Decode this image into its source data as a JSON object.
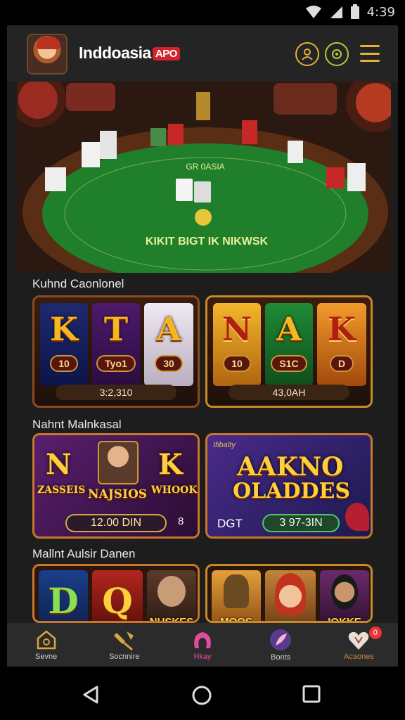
{
  "status_bar": {
    "time": "4:39"
  },
  "header": {
    "brand": "Inddoasia",
    "brand_badge": "APO"
  },
  "hero": {
    "table_text_top": "GR 0ASIA",
    "table_text_bottom": "KIKIT BIGT IK NIKWSK"
  },
  "sections": [
    {
      "title": "Kuhnd Caonlonel",
      "slots": [
        {
          "reels": [
            {
              "letter": "K",
              "chip": "10"
            },
            {
              "letter": "T",
              "chip": "Tyo1"
            },
            {
              "letter": "A",
              "chip": "30"
            }
          ],
          "footer": "3:2,310"
        },
        {
          "reels": [
            {
              "letter": "N",
              "chip": "10"
            },
            {
              "letter": "A",
              "chip": "S1C"
            },
            {
              "letter": "K",
              "chip": "D"
            }
          ],
          "footer": "43,0AH"
        }
      ]
    },
    {
      "title": "Nahnt Malnkasal",
      "left_card": {
        "letter_left": "N",
        "letter_right": "K",
        "banner_left": "ZASSEIS",
        "banner_mid": "NAJSIOS",
        "banner_right": "WHOOKE",
        "pill": "12.00 DIN",
        "pill_suffix": "8"
      },
      "right_card": {
        "tag": "Ifibalty",
        "title_line1": "AAKNO",
        "title_line2": "OLADDES",
        "left_label": "DGT",
        "pill": "3 97-3IN"
      }
    },
    {
      "title": "Mallnt Aulsir Danen",
      "thumbs": [
        {
          "letter": "D",
          "cap": ""
        },
        {
          "letter": "Q",
          "cap": ""
        },
        {
          "letter": "",
          "cap": "NUSKES"
        },
        {
          "letter": "",
          "cap": "MOOS"
        },
        {
          "letter": "",
          "cap": ""
        },
        {
          "letter": "",
          "cap": "IOKKE"
        }
      ]
    }
  ],
  "bottom_nav": [
    {
      "label": "Sevne",
      "icon": "home-icon"
    },
    {
      "label": "Socnnire",
      "icon": "hammer-icon"
    },
    {
      "label": "Hkay",
      "icon": "play-icon"
    },
    {
      "label": "Bonts",
      "icon": "feather-icon"
    },
    {
      "label": "Acaones",
      "icon": "gift-icon",
      "badge": "0"
    }
  ],
  "colors": {
    "accent": "#e5b13a",
    "active": "#e24aa0",
    "panel": "#1d1d1d"
  }
}
